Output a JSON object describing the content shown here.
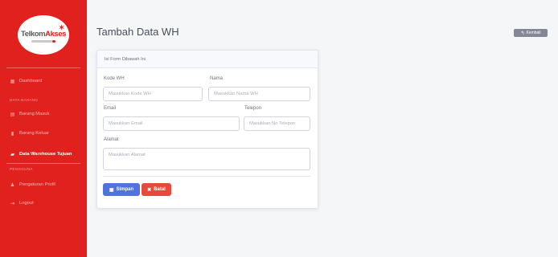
{
  "sidebar": {
    "logo": {
      "part1": "Telkom",
      "part2": "Akses"
    },
    "dashboard": "Dashboard",
    "section_data": "DATA BARANG",
    "items": [
      {
        "label": "Barang Masuk",
        "icon": "box-icon"
      },
      {
        "label": "Barang Keluar",
        "icon": "box-out-icon"
      },
      {
        "label": "Data Warehouse Tujuan",
        "icon": "warehouse-icon"
      }
    ],
    "section_user": "PENGGUNA",
    "profile": "Pengaturan Profil",
    "logout": "Logout"
  },
  "header": {
    "title": "Tambah Data WH",
    "back_label": "Kembali"
  },
  "form": {
    "card_title": "Isi Form Dibawah Ini",
    "kode_label": "Kode WH",
    "kode_placeholder": "Masukkan Kode WH",
    "nama_label": "Nama",
    "nama_placeholder": "Masukkan Nama WH",
    "email_label": "Email",
    "email_placeholder": "Masukkan Email",
    "telepon_label": "Telepon",
    "telepon_placeholder": "Masukkan No Telepon",
    "alamat_label": "Alamat",
    "alamat_placeholder": "Masukkan Alamat",
    "save_label": "Simpan",
    "cancel_label": "Batal"
  },
  "colors": {
    "sidebar": "#e0211d",
    "primary": "#4e73df",
    "danger": "#e74a3b",
    "secondary": "#858796"
  }
}
